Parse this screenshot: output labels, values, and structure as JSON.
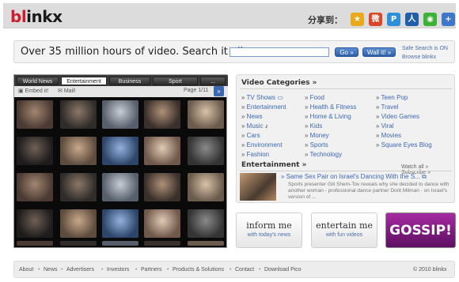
{
  "header": {
    "logo_part1": "bl",
    "logo_part2": "inkx",
    "share_label": "分享到：",
    "share_icons": [
      {
        "name": "qzone-icon",
        "color": "#e9a91a",
        "glyph": "★"
      },
      {
        "name": "weibo-icon",
        "color": "#d9472b",
        "glyph": "微"
      },
      {
        "name": "pengyou-icon",
        "color": "#2f8fd9",
        "glyph": "P"
      },
      {
        "name": "renren-icon",
        "color": "#1f5ea8",
        "glyph": "人"
      },
      {
        "name": "wechat-icon",
        "color": "#3bb237",
        "glyph": "◉"
      },
      {
        "name": "plus-icon",
        "color": "#3e77c9",
        "glyph": "+"
      }
    ]
  },
  "search": {
    "headline": "Over 35 million hours of video. Search it all.",
    "value": "",
    "go_label": "Go »",
    "wall_label": "Wall it! »",
    "safe_search": "Safe Search is ON",
    "browse": "Browse blinkx"
  },
  "video_panel": {
    "tabs": [
      "World News",
      "Entertainment",
      "Business",
      "Sport",
      "..."
    ],
    "active_tab": 1,
    "embed_label": "Embed it!",
    "mail_label": "Mail!",
    "page_label": "Page 1/11",
    "next_label": "»"
  },
  "categories": {
    "title": "Video Categories »",
    "col1": [
      "TV Shows",
      "Entertainment",
      "News",
      "Music",
      "Cars",
      "Environment",
      "Fashion"
    ],
    "col2": [
      "Food",
      "Health & Fitness",
      "Home & Living",
      "Kids",
      "Money",
      "Sports",
      "Technology"
    ],
    "col3": [
      "Teen Pop",
      "Travel",
      "Video Games",
      "Viral",
      "Movies",
      "Square Eyes Blog"
    ]
  },
  "entertainment": {
    "title": "Entertainment »",
    "links": "Watch all » Subscribe »",
    "headline": "Same Sex Pair on Israel's Dancing With the S...",
    "description": "Sports presenter Gili Shem-Tov reveals why she decided to dance with another woman - professional dance partner Dorit Milman - on Israel's version of ..."
  },
  "promos": [
    {
      "line1": "inform me",
      "line2": "with today's news"
    },
    {
      "line1": "entertain me",
      "line2": "with fun videos"
    }
  ],
  "gossip_label": "GOSSIP!",
  "footer": {
    "links": [
      "About",
      "News",
      "Advertisers",
      "Investors",
      "Partners",
      "Products & Solutions",
      "Contact",
      "Download Pico"
    ],
    "copyright": "© 2010 blinkx"
  },
  "colors": {
    "brand_red": "#cc1e2c",
    "link_blue": "#3d68b3",
    "button_blue": "#2d5fa8"
  }
}
